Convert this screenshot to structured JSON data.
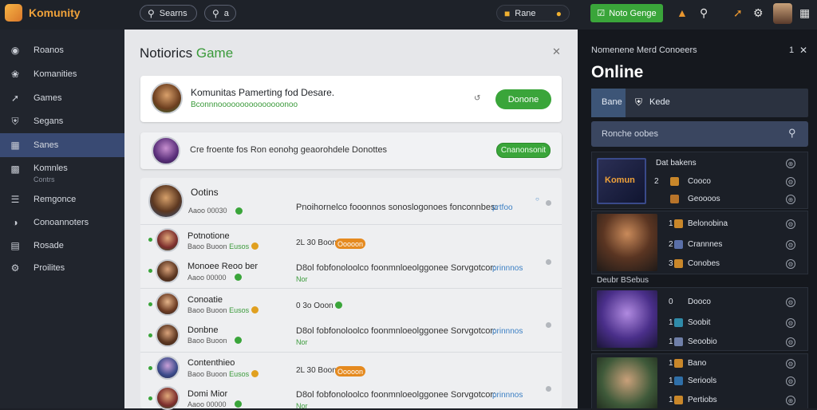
{
  "topbar": {
    "brand": "Komunity",
    "search_label": "Searns",
    "search2_label": "a",
    "center_label": "Rane",
    "cta_label": "Noto Genge"
  },
  "sidebar": {
    "items": [
      {
        "label": "Roanos",
        "icon": "compass-icon"
      },
      {
        "label": "Komanities",
        "icon": "leaf-icon"
      },
      {
        "label": "Games",
        "icon": "sword-icon"
      },
      {
        "label": "Segans",
        "icon": "shield-icon"
      },
      {
        "label": "Sanes",
        "icon": "grid-icon"
      },
      {
        "label": "Komnles",
        "sub": "Contrs",
        "icon": "image-icon"
      },
      {
        "label": "Remgonce",
        "icon": "menu-icon"
      },
      {
        "label": "Conoannoters",
        "icon": "globe-icon"
      },
      {
        "label": "Rosade",
        "icon": "box-icon"
      },
      {
        "label": "Proilites",
        "icon": "gear-icon"
      }
    ]
  },
  "panel": {
    "title_main": "Notiorics",
    "title_accent": "Game",
    "featured": {
      "title": "Komunitas Pamerting fod Desare.",
      "sub": "Bconnnooooooooooooooonoo",
      "button": "Donone"
    },
    "bar": {
      "text": "Cre froente fos Ron eonohg geaorohdele Donottes",
      "button": "Cnanonsonit"
    },
    "lead": {
      "name": "Ootins",
      "sub": "Aaoo 00030",
      "msg": "Pnoihornelco fooonnos sonoslogonoes fonconnbes:",
      "link": "prtfoo"
    },
    "rows": [
      {
        "name": "Potnotione",
        "sub": "Baoo Buoon",
        "sub2": "Eusos",
        "meta": "2L 30 Boon",
        "badge": "Ooooon",
        "msg": "",
        "link": ""
      },
      {
        "name": "Monoee Reoo ber",
        "sub": "Aaoo 00000",
        "sub2": "",
        "meta": "",
        "badge": "",
        "msg": "D8ol fobfonoloolco foonmnloeolggonee Sorvgotcor:",
        "link": "prinnnos",
        "tail": "Nor"
      },
      {
        "name": "Conoatie",
        "sub": "Baoo Buoon",
        "sub2": "Eusos",
        "meta": "0 3o Ooon",
        "badge": "",
        "msg": "",
        "link": ""
      },
      {
        "name": "Donbne",
        "sub": "Baoo Buoon",
        "sub2": "",
        "meta": "",
        "badge": "",
        "msg": "D8ol fobfonoloolco foonmnloeolggonee Sorvgotcor:",
        "link": "prinnnos",
        "tail": "Nor"
      },
      {
        "name": "Contenthieo",
        "sub": "Baoo Buoon",
        "sub2": "Eusos",
        "meta": "2L 30 Boon",
        "badge": "Ooooon",
        "msg": "",
        "link": ""
      },
      {
        "name": "Domi Mior",
        "sub": "Aaoo 00000",
        "sub2": "",
        "meta": "",
        "badge": "",
        "msg": "D8ol fobfonoloolco foonmnloeolggonee Sorvgotcor:",
        "link": "prinnnos",
        "tail": "Nor"
      }
    ]
  },
  "right": {
    "header": "Nomenene Merd Conoeers",
    "header_count": "1",
    "title": "Online",
    "tab1": "Bane",
    "tab2": "Kede",
    "search": "Ronche oobes",
    "games": [
      {
        "lines": [
          [
            "",
            "Dat bakens"
          ],
          [
            "2",
            "Cooco"
          ],
          [
            "3",
            "Geoooos"
          ]
        ],
        "thumb_text": "Komun"
      },
      {
        "lines": [
          [
            "1",
            "Belonobina"
          ],
          [
            "2",
            "Crannnes"
          ],
          [
            "3",
            "Conobes"
          ]
        ],
        "thumb_text": ""
      },
      {
        "label": "Deubr BSebus"
      },
      {
        "lines": [
          [
            "0",
            "Dooco"
          ],
          [
            "1",
            "Soobit"
          ],
          [
            "1",
            "Seoobio"
          ]
        ],
        "thumb_text": ""
      },
      {
        "lines": [
          [
            "1",
            "Bano"
          ],
          [
            "1",
            "Seriools"
          ],
          [
            "1",
            "Pertiobs"
          ]
        ],
        "thumb_text": ""
      }
    ]
  }
}
